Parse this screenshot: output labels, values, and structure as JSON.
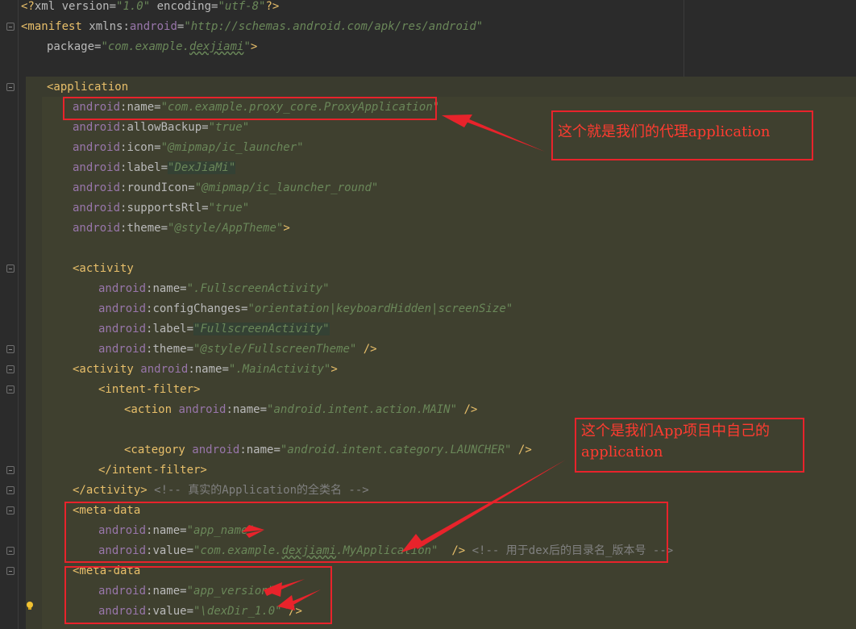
{
  "code_lines": [
    {
      "indent": 0,
      "parts": [
        [
          "t",
          "<?"
        ],
        [
          "a",
          "xml version="
        ],
        [
          "s",
          "\"1.0\""
        ],
        [
          "a",
          " encoding="
        ],
        [
          "s",
          "\"utf-8\""
        ],
        [
          "t",
          "?>"
        ]
      ]
    },
    {
      "indent": 0,
      "parts": [
        [
          "t",
          "<manifest "
        ],
        [
          "a",
          "xmlns:"
        ],
        [
          "ns",
          "android"
        ],
        [
          "a",
          "="
        ],
        [
          "s",
          "\"http://schemas.android.com/apk/res/android\""
        ]
      ]
    },
    {
      "indent": 1,
      "parts": [
        [
          "a",
          "package="
        ],
        [
          "s",
          "\"com.example."
        ],
        [
          "su",
          "dexjiami"
        ],
        [
          "s",
          "\""
        ],
        [
          "t",
          ">"
        ]
      ]
    },
    {
      "indent": 0,
      "parts": []
    },
    {
      "indent": 1,
      "parts": [
        [
          "t",
          "<application"
        ]
      ]
    },
    {
      "indent": 2,
      "parts": [
        [
          "ns",
          "android"
        ],
        [
          "a",
          ":name="
        ],
        [
          "s",
          "\"com.example.proxy_core.ProxyApplication\""
        ]
      ]
    },
    {
      "indent": 2,
      "parts": [
        [
          "ns",
          "android"
        ],
        [
          "a",
          ":allowBackup="
        ],
        [
          "s",
          "\"true\""
        ]
      ]
    },
    {
      "indent": 2,
      "parts": [
        [
          "ns",
          "android"
        ],
        [
          "a",
          ":icon="
        ],
        [
          "s",
          "\"@mipmap/ic_launcher\""
        ]
      ]
    },
    {
      "indent": 2,
      "parts": [
        [
          "ns",
          "android"
        ],
        [
          "a",
          ":label="
        ],
        [
          "sh",
          "\"DexJiaMi\""
        ]
      ]
    },
    {
      "indent": 2,
      "parts": [
        [
          "ns",
          "android"
        ],
        [
          "a",
          ":roundIcon="
        ],
        [
          "s",
          "\"@mipmap/ic_launcher_round\""
        ]
      ]
    },
    {
      "indent": 2,
      "parts": [
        [
          "ns",
          "android"
        ],
        [
          "a",
          ":supportsRtl="
        ],
        [
          "s",
          "\"true\""
        ]
      ]
    },
    {
      "indent": 2,
      "parts": [
        [
          "ns",
          "android"
        ],
        [
          "a",
          ":theme="
        ],
        [
          "s",
          "\"@style/AppTheme\""
        ],
        [
          "t",
          ">"
        ]
      ]
    },
    {
      "indent": 0,
      "parts": []
    },
    {
      "indent": 2,
      "parts": [
        [
          "t",
          "<activity"
        ]
      ]
    },
    {
      "indent": 3,
      "parts": [
        [
          "ns",
          "android"
        ],
        [
          "a",
          ":name="
        ],
        [
          "s",
          "\".FullscreenActivity\""
        ]
      ]
    },
    {
      "indent": 3,
      "parts": [
        [
          "ns",
          "android"
        ],
        [
          "a",
          ":configChanges="
        ],
        [
          "s",
          "\"orientation|keyboardHidden|screenSize\""
        ]
      ]
    },
    {
      "indent": 3,
      "parts": [
        [
          "ns",
          "android"
        ],
        [
          "a",
          ":label="
        ],
        [
          "sh",
          "\"FullscreenActivity\""
        ]
      ]
    },
    {
      "indent": 3,
      "parts": [
        [
          "ns",
          "android"
        ],
        [
          "a",
          ":theme="
        ],
        [
          "s",
          "\"@style/FullscreenTheme\""
        ],
        [
          "t",
          " />"
        ]
      ]
    },
    {
      "indent": 2,
      "parts": [
        [
          "t",
          "<activity "
        ],
        [
          "ns",
          "android"
        ],
        [
          "a",
          ":name="
        ],
        [
          "s",
          "\".MainActivity\""
        ],
        [
          "t",
          ">"
        ]
      ]
    },
    {
      "indent": 3,
      "parts": [
        [
          "t",
          "<intent-filter>"
        ]
      ]
    },
    {
      "indent": 4,
      "parts": [
        [
          "t",
          "<action "
        ],
        [
          "ns",
          "android"
        ],
        [
          "a",
          ":name="
        ],
        [
          "s",
          "\"android.intent.action.MAIN\""
        ],
        [
          "t",
          " />"
        ]
      ]
    },
    {
      "indent": 0,
      "parts": []
    },
    {
      "indent": 4,
      "parts": [
        [
          "t",
          "<category "
        ],
        [
          "ns",
          "android"
        ],
        [
          "a",
          ":name="
        ],
        [
          "s",
          "\"android.intent.category.LAUNCHER\""
        ],
        [
          "t",
          " />"
        ]
      ]
    },
    {
      "indent": 3,
      "parts": [
        [
          "t",
          "</intent-filter>"
        ]
      ]
    },
    {
      "indent": 2,
      "parts": [
        [
          "t",
          "</activity>"
        ],
        [
          "c",
          " <!-- 真实的Application的全类名 -->"
        ]
      ]
    },
    {
      "indent": 2,
      "parts": [
        [
          "t",
          "<meta-data"
        ]
      ]
    },
    {
      "indent": 3,
      "parts": [
        [
          "ns",
          "android"
        ],
        [
          "a",
          ":name="
        ],
        [
          "s",
          "\"app_name\""
        ]
      ]
    },
    {
      "indent": 3,
      "parts": [
        [
          "ns",
          "android"
        ],
        [
          "a",
          ":value="
        ],
        [
          "s",
          "\"com.example."
        ],
        [
          "su",
          "dexjiami"
        ],
        [
          "s",
          ".MyApplication\""
        ],
        [
          "t",
          "  />"
        ],
        [
          "c",
          " <!-- 用于dex后的目录名_版本号 -->"
        ]
      ]
    },
    {
      "indent": 2,
      "parts": [
        [
          "t",
          "<meta-data"
        ]
      ]
    },
    {
      "indent": 3,
      "parts": [
        [
          "ns",
          "android"
        ],
        [
          "a",
          ":name="
        ],
        [
          "s",
          "\"app_version\""
        ]
      ]
    },
    {
      "indent": 3,
      "parts": [
        [
          "ns",
          "android"
        ],
        [
          "a",
          ":value="
        ],
        [
          "s",
          "\"\\dexDir_1.0\""
        ],
        [
          "t",
          " />"
        ]
      ]
    }
  ],
  "annotations": {
    "proxy_application": "这个就是我们的代理application",
    "own_application_line1": "这个是我们App项目中自己的",
    "own_application_line2": "application"
  },
  "colors": {
    "background": "#2b2b2b",
    "tag": "#e8bf6a",
    "attribute": "#bababa",
    "namespace": "#9876aa",
    "string": "#6a8759",
    "comment": "#808080",
    "annotation": "#e8232b"
  },
  "icons": {
    "fold_marker": "fold-marker-icon",
    "intention_bulb": "lightbulb-icon"
  }
}
